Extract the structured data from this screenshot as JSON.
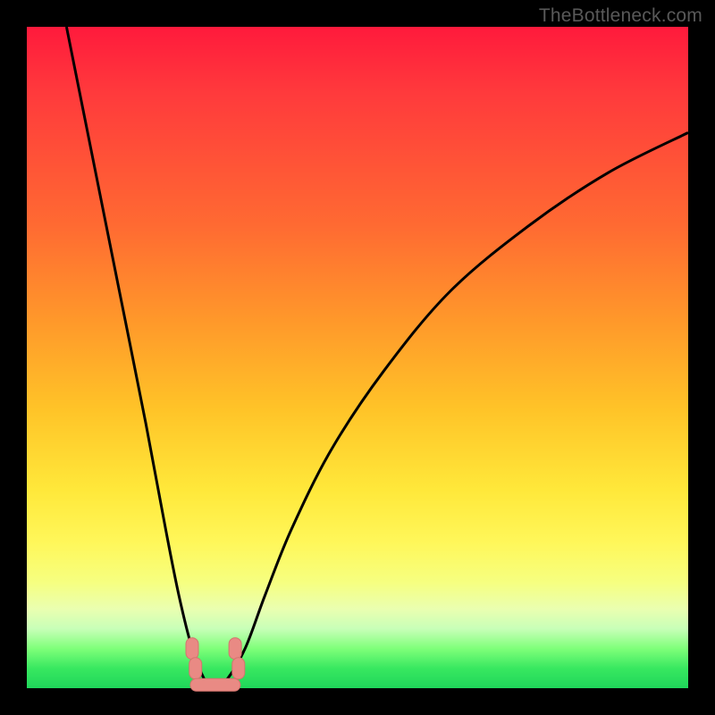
{
  "watermark": "TheBottleneck.com",
  "chart_data": {
    "type": "line",
    "title": "",
    "xlabel": "",
    "ylabel": "",
    "xlim": [
      0,
      100
    ],
    "ylim": [
      0,
      100
    ],
    "series": [
      {
        "name": "bottleneck-curve",
        "x": [
          6,
          10,
          14,
          18,
          21,
          23,
          25,
          27,
          28,
          30,
          33,
          36,
          40,
          46,
          54,
          64,
          76,
          88,
          100
        ],
        "values": [
          100,
          80,
          60,
          40,
          24,
          14,
          6,
          1,
          0,
          1,
          6,
          14,
          24,
          36,
          48,
          60,
          70,
          78,
          84
        ]
      }
    ],
    "markers": [
      {
        "name": "left-node-upper",
        "x": 25.0,
        "y": 6.0
      },
      {
        "name": "left-node-lower",
        "x": 25.5,
        "y": 3.0
      },
      {
        "name": "right-node-upper",
        "x": 31.5,
        "y": 6.0
      },
      {
        "name": "right-node-lower",
        "x": 32.0,
        "y": 3.0
      },
      {
        "name": "bottom-bar",
        "x": 28.5,
        "y": 0.5
      }
    ],
    "colors": {
      "curve": "#000000",
      "marker_fill": "#e98a84",
      "marker_stroke": "#d4746e"
    }
  }
}
